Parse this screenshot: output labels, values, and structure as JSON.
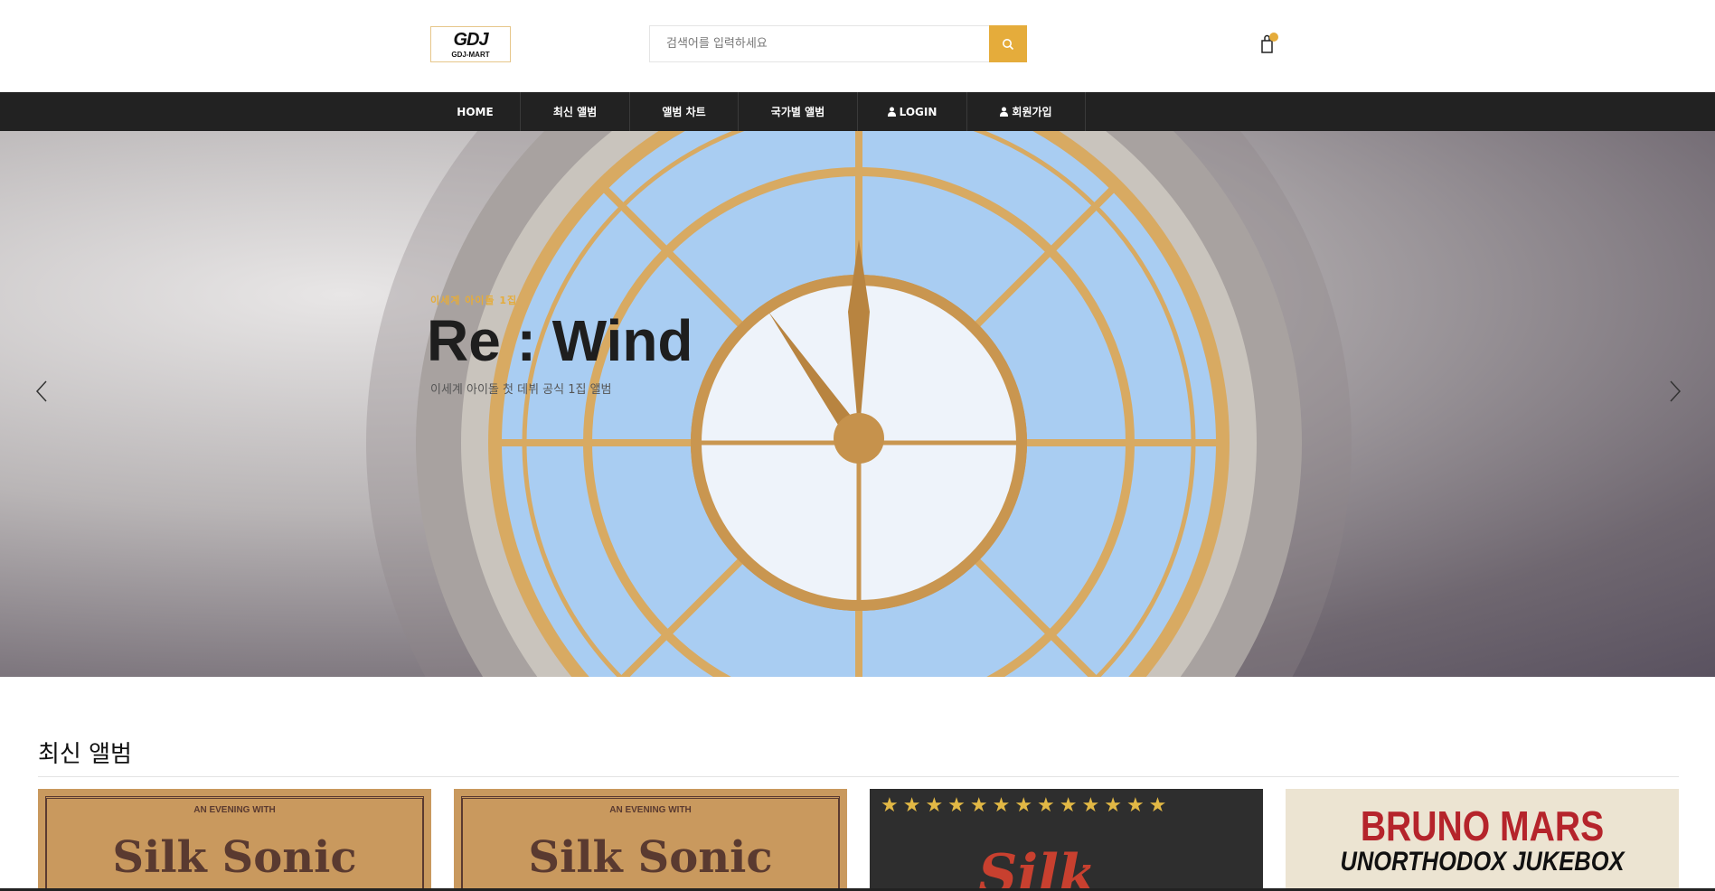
{
  "header": {
    "logo": {
      "title": "GDJ",
      "subtitle": "GDJ-MART"
    },
    "search": {
      "placeholder": "검색어를 입력하세요"
    },
    "icons": {
      "search": "search-icon",
      "cart": "shopping-bag-icon"
    }
  },
  "nav": {
    "items": [
      {
        "label": "HOME"
      },
      {
        "label": "최신 앨범"
      },
      {
        "label": "앨범 차트"
      },
      {
        "label": "국가별 앨범"
      },
      {
        "label": "LOGIN",
        "icon": "user-icon"
      },
      {
        "label": "회원가입",
        "icon": "user-icon"
      }
    ]
  },
  "hero": {
    "subtitle": "이세계 아이돌 1집",
    "title": "Re : Wind",
    "description": "이세계 아이돌 첫 데뷔 공식 1집 앨범"
  },
  "section": {
    "title": "최신 앨범",
    "albums": [
      {
        "top_text": "AN EVENING WITH",
        "cover_text": "Silk Sonic"
      },
      {
        "top_text": "AN EVENING WITH",
        "cover_text": "Silk Sonic"
      },
      {
        "cover_text": "Silk"
      },
      {
        "cover_text": "BRUNO MARS",
        "cover_sub": "UNORTHODOX JUKEBOX"
      }
    ]
  },
  "colors": {
    "accent": "#e5ac3b",
    "nav_bg": "#222222"
  }
}
